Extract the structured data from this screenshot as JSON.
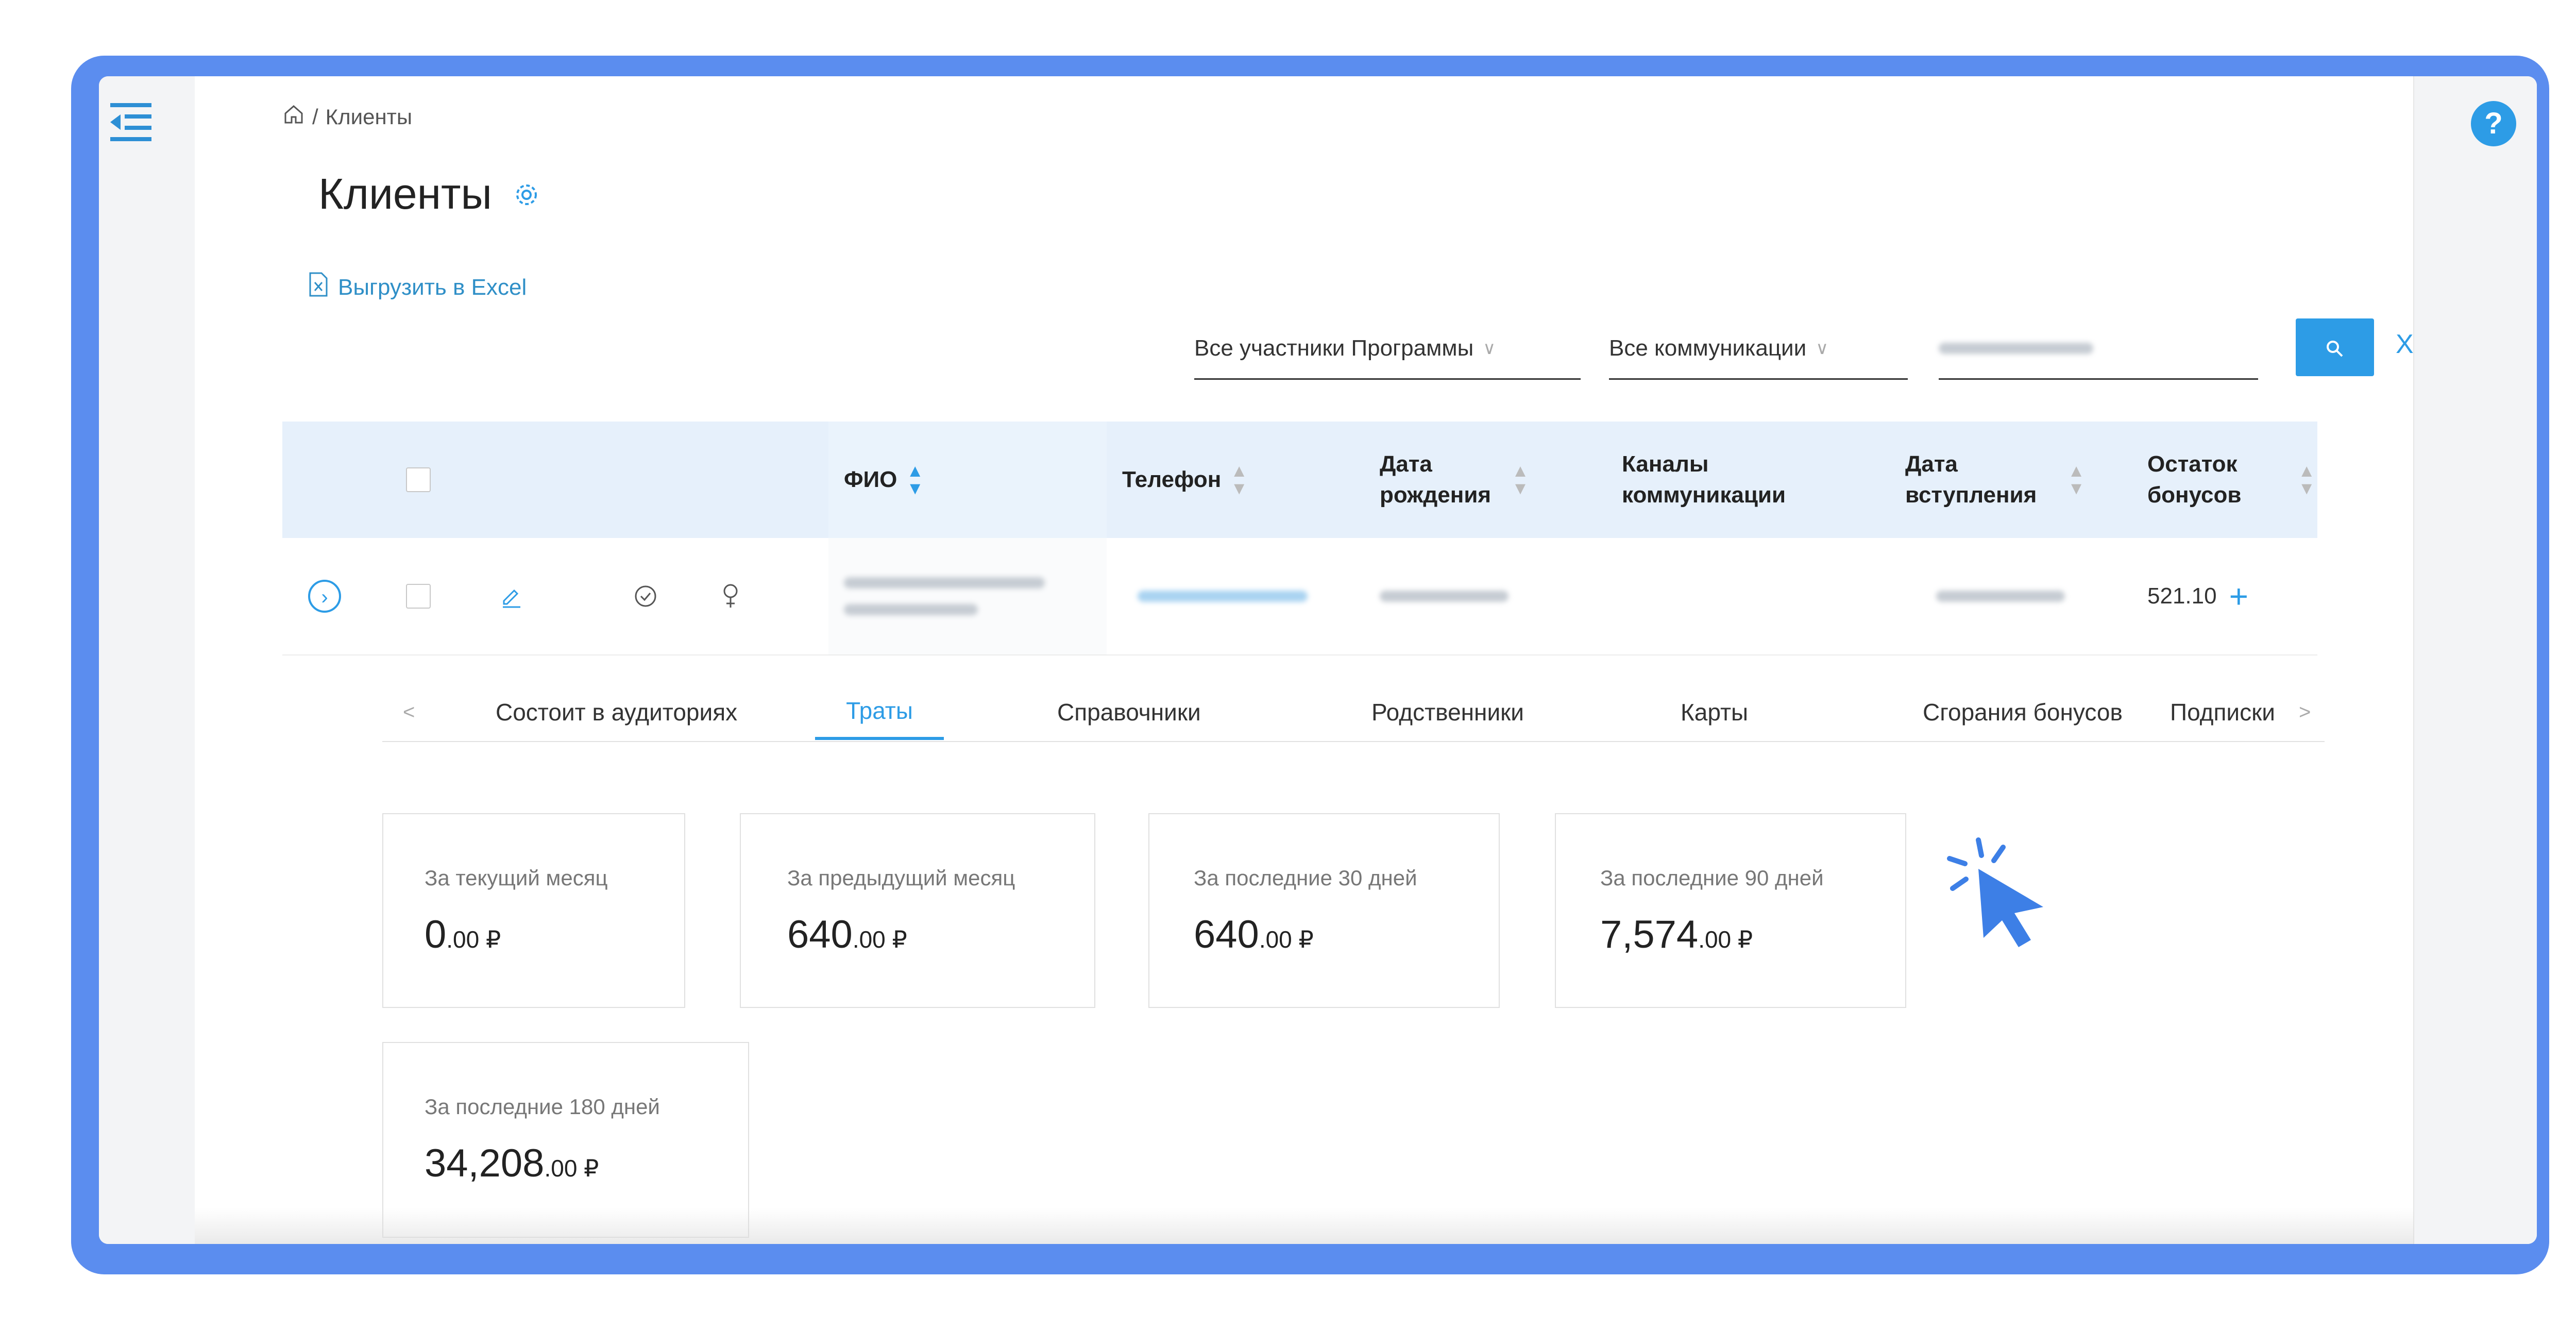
{
  "help_label": "?",
  "breadcrumb": {
    "separator": "/",
    "current": "Клиенты"
  },
  "page_title": "Клиенты",
  "export_label": "Выгрузить в Excel",
  "filters": {
    "participants": "Все участники Программы",
    "communications": "Все коммуникации",
    "clear": "X"
  },
  "table": {
    "headers": {
      "fio": "ФИО",
      "phone": "Телефон",
      "birth": [
        "Дата",
        "рождения"
      ],
      "channels": [
        "Каналы",
        "коммуникации"
      ],
      "joined": [
        "Дата",
        "вступления"
      ],
      "bonus": [
        "Остаток",
        "бонусов"
      ]
    },
    "row": {
      "bonus_balance": "521.10",
      "plus": "+"
    }
  },
  "tabs": [
    "Состоит в аудиториях",
    "Траты",
    "Справочники",
    "Родственники",
    "Карты",
    "Сгорания бонусов",
    "Подписки"
  ],
  "active_tab": "Траты",
  "spending_cards": [
    {
      "caption": "За текущий месяц",
      "amount": "0",
      "fraction": ".00 ₽"
    },
    {
      "caption": "За предыдущий месяц",
      "amount": "640",
      "fraction": ".00 ₽"
    },
    {
      "caption": "За последние 30 дней",
      "amount": "640",
      "fraction": ".00 ₽"
    },
    {
      "caption": "За последние 90 дней",
      "amount": "7,574",
      "fraction": ".00 ₽"
    },
    {
      "caption": "За последние 180 дней",
      "amount": "34,208",
      "fraction": ".00 ₽"
    }
  ],
  "colors": {
    "frame": "#5b8def",
    "accent": "#2d9ce6",
    "header_bg": "#e6f0fb"
  }
}
